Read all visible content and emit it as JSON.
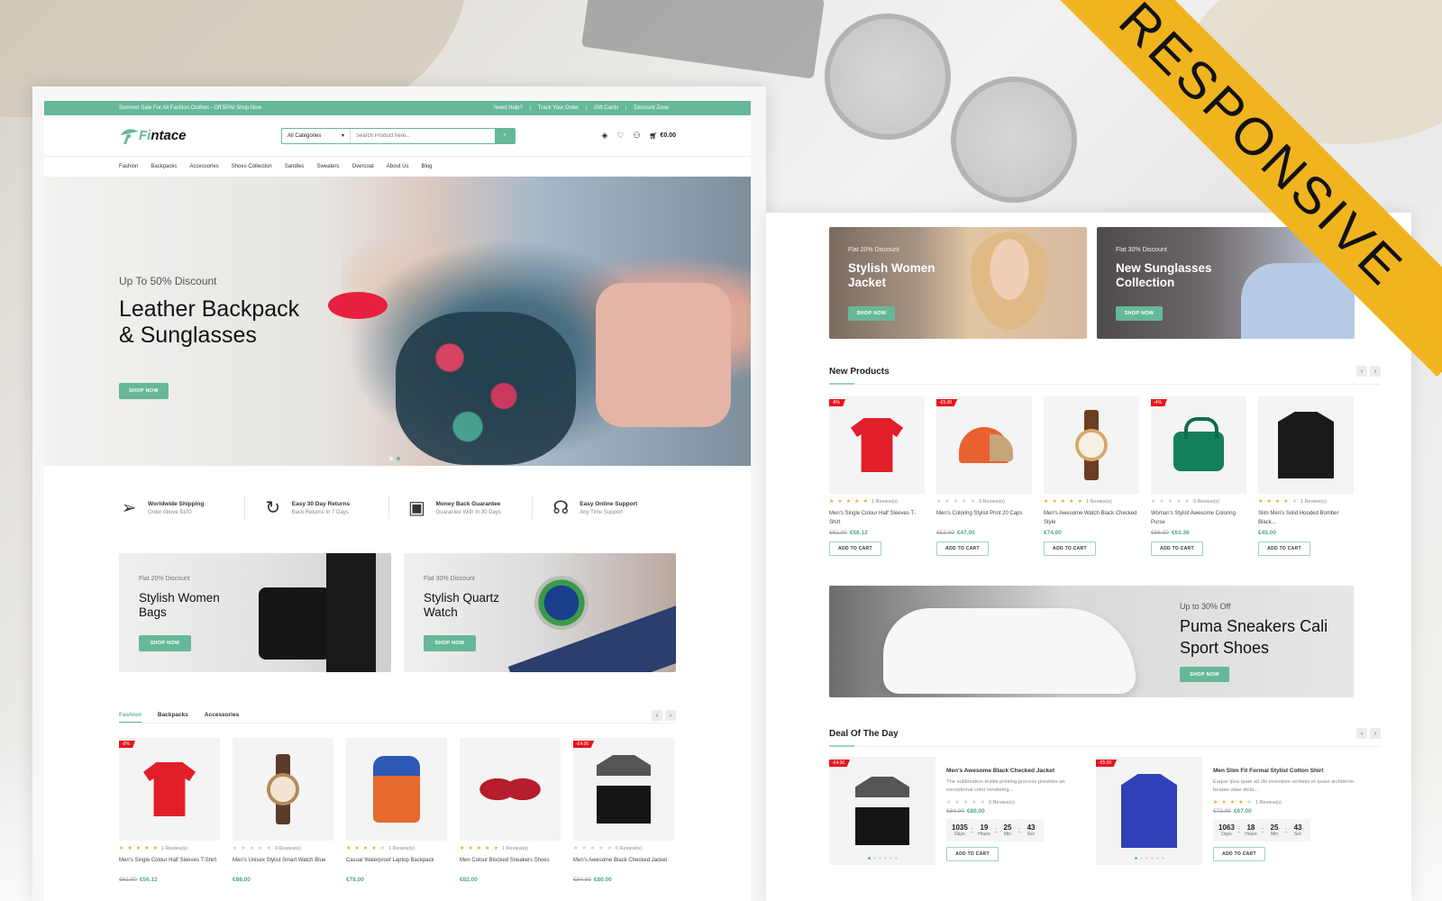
{
  "badge_ribbon": "RESPONSIVE",
  "topbar": {
    "promo": "Summer Sale For All Fashion Clothes - Off 50%! Shop Now",
    "links": [
      "Need Help?",
      "Track Your Order",
      "Gift Cards",
      "Discount Zone"
    ]
  },
  "header": {
    "logo_prefix": "Fi",
    "logo_suffix": "ntace",
    "category_select": "All Categories",
    "search_placeholder": "Search Product here...",
    "cart_total": "€0.00",
    "cart_count": "0",
    "icons": [
      "compare-icon",
      "wishlist-icon",
      "user-icon",
      "cart-icon"
    ]
  },
  "nav": [
    "Fashion",
    "Backpacks",
    "Accessories",
    "Shoes Collection",
    "Sandles",
    "Sweaters",
    "Overcoat",
    "About Us",
    "Blog"
  ],
  "hero": {
    "subtitle": "Up To 50% Discount",
    "title_line1": "Leather Backpack",
    "title_line2": "& Sunglasses",
    "button": "SHOP NOW",
    "slides": 2,
    "active_slide": 1
  },
  "features": [
    {
      "icon": "paper-plane-icon",
      "title": "Worldwide Shipping",
      "subtitle": "Order Above $100"
    },
    {
      "icon": "returns-icon",
      "title": "Easy 30 Day Returns",
      "subtitle": "Back Returns In 7 Days"
    },
    {
      "icon": "wallet-icon",
      "title": "Money Back Guarantee",
      "subtitle": "Guarantee With In 30 Days"
    },
    {
      "icon": "headset-icon",
      "title": "Easy Online Support",
      "subtitle": "Any Time Support"
    }
  ],
  "promo_banners": [
    {
      "small": "Flat 20% Discount",
      "line1": "Stylish Women",
      "line2": "Bags",
      "button": "SHOP NOW"
    },
    {
      "small": "Flat 30% Discount",
      "line1": "Stylish Quartz",
      "line2": "Watch",
      "button": "SHOP NOW"
    }
  ],
  "product_tabs": {
    "tabs": [
      "Fashion",
      "Backpacks",
      "Accessories"
    ],
    "active": "Fashion",
    "prev": "‹",
    "next": "›"
  },
  "tab_products": [
    {
      "badge": "-8%",
      "rating": 5,
      "reviews": "1 Review(s)",
      "name": "Men's Single Colour Half Sleeves T-Shirt",
      "old_price": "€61.00",
      "price": "€56.12",
      "art": "tee"
    },
    {
      "badge": "",
      "rating": 0,
      "reviews": "0 Review(s)",
      "name": "Men's Unisex Stylist Smart Watch Blue",
      "old_price": "",
      "price": "€88.00",
      "art": "watch"
    },
    {
      "badge": "",
      "rating": 4,
      "reviews": "1 Review(s)",
      "name": "Casual Waterproof Laptop Backpack",
      "old_price": "",
      "price": "€78.00",
      "art": "backpack"
    },
    {
      "badge": "",
      "rating": 5,
      "reviews": "1 Review(s)",
      "name": "Men Colour Blocked Sneakers Shoes",
      "old_price": "",
      "price": "€82.00",
      "art": "shoes"
    },
    {
      "badge": "-€4.00",
      "rating": 0,
      "reviews": "0 Review(s)",
      "name": "Men's Awesome Black Checked Jacket",
      "old_price": "€84.00",
      "price": "€80.00",
      "art": "jacket"
    }
  ],
  "right_banners": [
    {
      "small": "Flat 20% Discount",
      "line1": "Stylish Women",
      "line2": "Jacket",
      "button": "SHOP NOW"
    },
    {
      "small": "Flat 30% Discount",
      "line1": "New Sunglasses",
      "line2": "Collection",
      "button": "SHOP NOW"
    }
  ],
  "new_products": {
    "title": "New Products",
    "prev": "‹",
    "next": "›",
    "add_to_cart": "ADD TO CART",
    "items": [
      {
        "badge": "-8%",
        "rating": 5,
        "reviews": "1 Review(s)",
        "name": "Men's Single Colour Half Sleeves T-Shirt",
        "old_price": "€61.00",
        "price": "€56.12",
        "art": "tee"
      },
      {
        "badge": "-€5.00",
        "rating": 0,
        "reviews": "0 Review(s)",
        "name": "Men's Coloring Stylist Print 20 Caps",
        "old_price": "€52.00",
        "price": "€47.00",
        "art": "cap"
      },
      {
        "badge": "",
        "rating": 5,
        "reviews": "1 Review(s)",
        "name": "Men's Awesome Watch Black Checked Style",
        "old_price": "",
        "price": "€74.00",
        "art": "watch2"
      },
      {
        "badge": "-4%",
        "rating": 0,
        "reviews": "0 Review(s)",
        "name": "Woman's Stylist Awesome Coloring Purse",
        "old_price": "€66.00",
        "price": "€63.36",
        "art": "purse"
      },
      {
        "badge": "",
        "rating": 4,
        "reviews": "1 Review(s)",
        "name": "Slim Men's Solid Hooded Bomber Black...",
        "old_price": "",
        "price": "€45.00",
        "art": "bomber"
      }
    ]
  },
  "sneaker_banner": {
    "small": "Up to 30% Off",
    "line1": "Puma Sneakers Cali",
    "line2": "Sport Shoes",
    "button": "SHOP NOW"
  },
  "deal_of_day": {
    "title": "Deal Of The Day",
    "prev": "‹",
    "next": "›",
    "add_to_cart": "ADD TO CART",
    "labels": {
      "days": "Days",
      "hours": "Hours",
      "min": "Min",
      "sec": "Sec"
    },
    "items": [
      {
        "badge": "-€4.00",
        "name": "Men's Awesome Black Checked Jacket",
        "desc": "The sublimation textile printing process provides an exceptional color rendering...",
        "rating": 0,
        "reviews": "0 Review(s)",
        "old_price": "€84.00",
        "price": "€80.00",
        "days": "1035",
        "hours": "19",
        "min": "25",
        "sec": "43",
        "art": "jacket"
      },
      {
        "badge": "-€5.00",
        "name": "Men Slim Fit Formal Stylist Cotton Shirt",
        "desc": "Eaque ipsa quae ab illo inventore veritatis et quasi architecto beatae vitae dicta...",
        "rating": 4,
        "reviews": "1 Review(s)",
        "old_price": "€72.00",
        "price": "€67.00",
        "days": "1063",
        "hours": "18",
        "min": "25",
        "sec": "43",
        "art": "shirt"
      }
    ]
  },
  "colors": {
    "brand_green": "#66b898",
    "sale_red": "#e8141d",
    "ribbon_yellow": "#f0b41e",
    "star": "#f5a623"
  }
}
